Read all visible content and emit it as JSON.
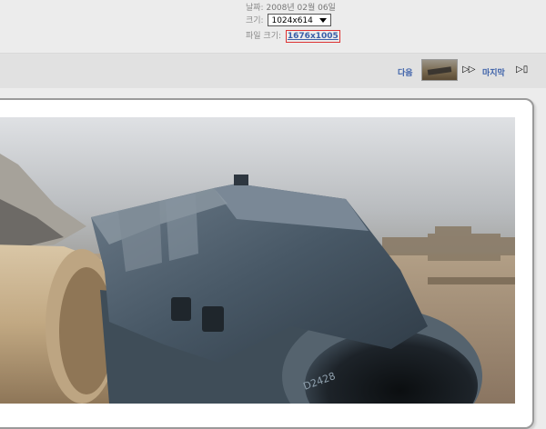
{
  "meta": {
    "date_label": "날짜:",
    "date_value": "2008년 02월 06일",
    "size_label": "크기:",
    "size_selected": "1024x614",
    "file_size_label": "파일 크기:",
    "file_size_value": "1676x1005"
  },
  "navigation": {
    "next_label": "다음",
    "next_arrows": "▷▷",
    "last_label": "마지막",
    "last_icon": "▷▯"
  },
  "photo": {
    "barrel_text": "D2428"
  },
  "colors": {
    "link": "#3a5fa8",
    "highlight_border": "#d33333",
    "background": "#ececec",
    "navbar": "#e1e1e1"
  },
  "icons": [
    "chevron-down-icon",
    "next-arrows-icon",
    "last-end-icon"
  ]
}
